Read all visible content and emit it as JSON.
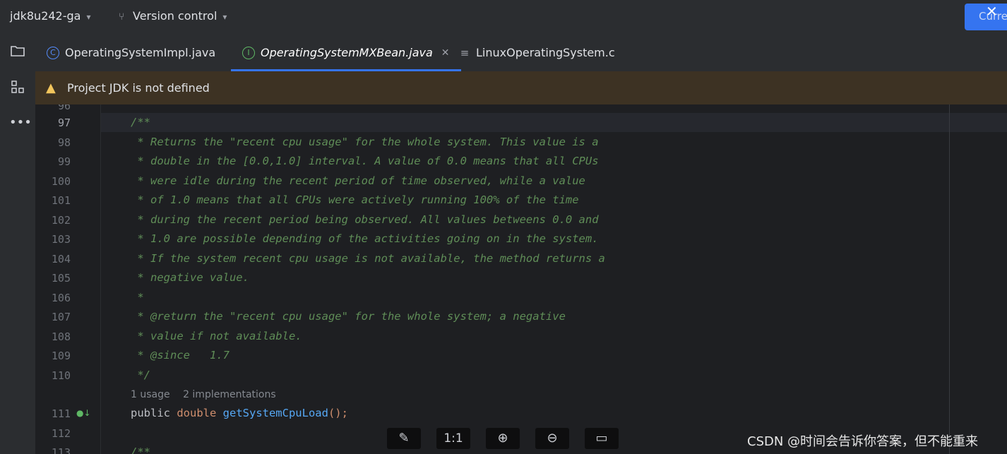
{
  "header": {
    "project": "jdk8u242-ga",
    "vcs": "Version control",
    "corner_button": "Curre"
  },
  "tabs": [
    {
      "label": "OperatingSystemImpl.java",
      "icon": "C"
    },
    {
      "label": "OperatingSystemMXBean.java",
      "icon": "I"
    },
    {
      "label": "LinuxOperatingSystem.c",
      "icon": "≡"
    }
  ],
  "banner": {
    "text": "Project JDK is not defined"
  },
  "editor": {
    "lines": [
      {
        "n": "97",
        "text": "/**"
      },
      {
        "n": "98",
        "text": " * Returns the \"recent cpu usage\" for the whole system. This value is a"
      },
      {
        "n": "99",
        "text": " * double in the [0.0,1.0] interval. A value of 0.0 means that all CPUs"
      },
      {
        "n": "100",
        "text": " * were idle during the recent period of time observed, while a value"
      },
      {
        "n": "101",
        "text": " * of 1.0 means that all CPUs were actively running 100% of the time"
      },
      {
        "n": "102",
        "text": " * during the recent period being observed. All values betweens 0.0 and"
      },
      {
        "n": "103",
        "text": " * 1.0 are possible depending of the activities going on in the system."
      },
      {
        "n": "104",
        "text": " * If the system recent cpu usage is not available, the method returns a"
      },
      {
        "n": "105",
        "text": " * negative value."
      },
      {
        "n": "106",
        "text": " *"
      },
      {
        "n": "107",
        "text": " * @return the \"recent cpu usage\" for the whole system; a negative"
      },
      {
        "n": "108",
        "text": " * value if not available."
      },
      {
        "n": "109",
        "text": " * @since   1.7"
      },
      {
        "n": "110",
        "text": " */"
      }
    ],
    "hints": {
      "usages": "1 usage",
      "impls": "2 implementations"
    },
    "decl": {
      "n": "111",
      "mod": "public ",
      "type": "double ",
      "name": "getSystemCpuLoad",
      "rest": "();"
    },
    "line112": "112",
    "line113": "113",
    "line113_text": "/**"
  },
  "image_toolbar": {
    "actual_size": "1:1"
  },
  "watermark": "CSDN @时间会告诉你答案，但不能重来"
}
